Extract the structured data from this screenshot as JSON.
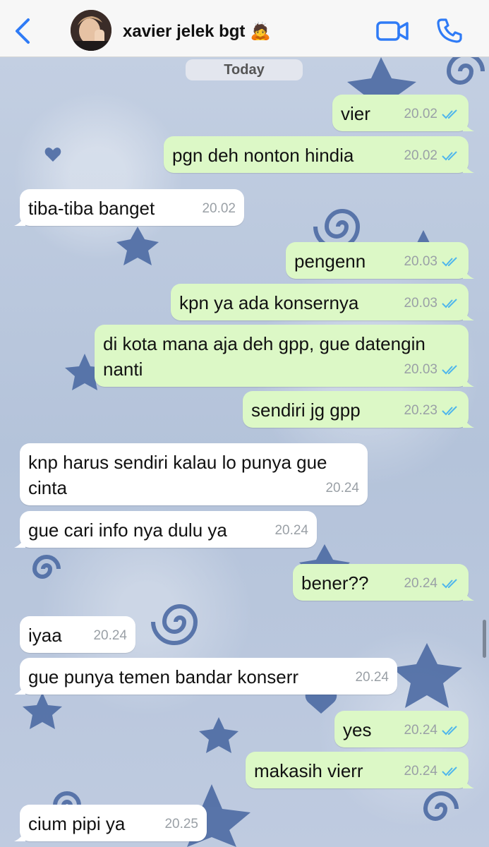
{
  "header": {
    "title": "xavier jelek bgt 🙇",
    "back_icon": "chevron-left-icon",
    "video_icon": "video-call-icon",
    "call_icon": "phone-icon",
    "accent": "#2f7bf6"
  },
  "date_chip": "Today",
  "messages": [
    {
      "dir": "out",
      "text": "vier",
      "time": "20.02",
      "read": true
    },
    {
      "dir": "out",
      "text": "pgn deh nonton hindia",
      "time": "20.02",
      "read": true
    },
    {
      "dir": "in",
      "text": "tiba-tiba banget",
      "time": "20.02"
    },
    {
      "dir": "out",
      "text": "pengenn",
      "time": "20.03",
      "read": true
    },
    {
      "dir": "out",
      "text": "kpn ya ada konsernya",
      "time": "20.03",
      "read": true
    },
    {
      "dir": "out",
      "line1": "di kota mana aja deh gpp, gue datengin",
      "line2": "nanti",
      "time": "20.03",
      "read": true
    },
    {
      "dir": "out",
      "text": "sendiri jg gpp",
      "time": "20.23",
      "read": true
    },
    {
      "dir": "in",
      "line1": "knp harus sendiri kalau lo punya gue",
      "line2": "cinta",
      "time": "20.24"
    },
    {
      "dir": "in",
      "text": "gue cari info nya dulu ya",
      "time": "20.24"
    },
    {
      "dir": "out",
      "text": "bener??",
      "time": "20.24",
      "read": true
    },
    {
      "dir": "in",
      "text": "iyaa",
      "time": "20.24"
    },
    {
      "dir": "in",
      "text": "gue punya temen bandar konserr",
      "time": "20.24"
    },
    {
      "dir": "out",
      "text": "yes",
      "time": "20.24",
      "read": true
    },
    {
      "dir": "out",
      "text": "makasih vierr",
      "time": "20.24",
      "read": true
    },
    {
      "dir": "in",
      "text": "cium pipi ya",
      "time": "20.25"
    }
  ],
  "colors": {
    "outgoing_bubble": "#dcf8c6",
    "incoming_bubble": "#ffffff",
    "read_tick": "#4fb6ec",
    "wallpaper": "#b7c6dc"
  }
}
